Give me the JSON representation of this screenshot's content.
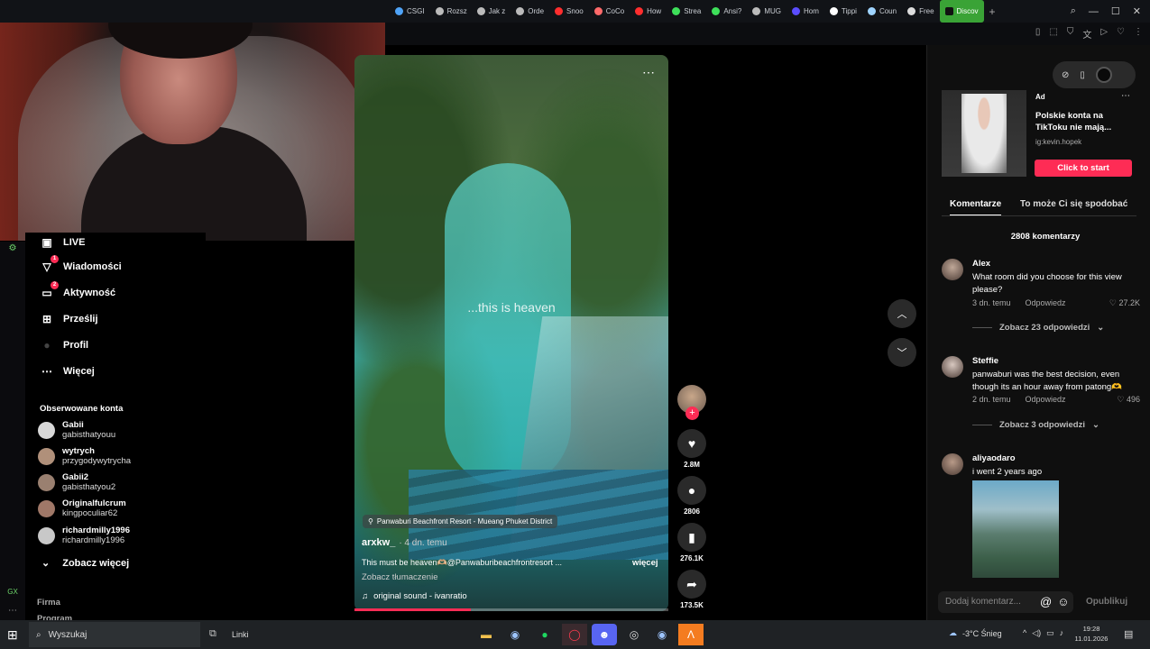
{
  "browser": {
    "tabs": [
      {
        "label": "CSGI",
        "color": "#4fa3f7"
      },
      {
        "label": "Rozsz",
        "color": "#bbbbbb"
      },
      {
        "label": "Jak z",
        "color": "#bbbbbb"
      },
      {
        "label": "Orde",
        "color": "#bbbbbb"
      },
      {
        "label": "Snoo",
        "color": "#ff2e2e"
      },
      {
        "label": "CoCo",
        "color": "#ff6a6a"
      },
      {
        "label": "How",
        "color": "#ff2e2e"
      },
      {
        "label": "Strea",
        "color": "#3ee05a"
      },
      {
        "label": "Ansi?",
        "color": "#3ee05a"
      },
      {
        "label": "MUG",
        "color": "#bbbbbb"
      },
      {
        "label": "Hom",
        "color": "#5b4dff"
      },
      {
        "label": "Tippi",
        "color": "#ffffff"
      },
      {
        "label": "Coun",
        "color": "#9fd4ff"
      },
      {
        "label": "Free",
        "color": "#dddddd"
      }
    ],
    "active_tab": {
      "label": "Discov",
      "color": "#3aa336"
    },
    "new_tab": "+"
  },
  "sidebar": {
    "items": [
      {
        "label": "LIVE",
        "icon": "live-icon"
      },
      {
        "label": "Wiadomości",
        "icon": "messages-icon",
        "badge": "1"
      },
      {
        "label": "Aktywność",
        "icon": "activity-icon",
        "badge": "2"
      },
      {
        "label": "Prześlij",
        "icon": "upload-icon"
      },
      {
        "label": "Profil",
        "icon": "profile-icon"
      },
      {
        "label": "Więcej",
        "icon": "more-icon"
      }
    ],
    "followed_title": "Obserwowane konta",
    "accounts": [
      {
        "name": "Gabii",
        "handle": "gabisthatyouu",
        "color": "#d8d8d8"
      },
      {
        "name": "wytrych",
        "handle": "przygodywytrycha",
        "color": "#b0907a"
      },
      {
        "name": "Gabii2",
        "handle": "gabisthatyou2",
        "color": "#9a8070"
      },
      {
        "name": "Originalfulcrum",
        "handle": "kingpoculiar62",
        "color": "#a07868"
      },
      {
        "name": "richardmilly1996",
        "handle": "richardmilly1996",
        "color": "#c8c8c8"
      }
    ],
    "see_more": "Zobacz więcej",
    "footer": [
      "Firma",
      "Program"
    ]
  },
  "video": {
    "overlay_text": "...this is heaven",
    "location": "Panwaburi Beachfront Resort - Mueang Phuket District",
    "author": "arxkw_",
    "time": "· 4 dn. temu",
    "caption": "This must be heaven🫶🏼@Panwaburibeachfrontresort ...",
    "more": "więcej",
    "translate": "Zobacz tłumaczenie",
    "sound": "original sound - ivanratio",
    "progress": 0.37
  },
  "actions": {
    "likes": "2.8M",
    "comments": "2806",
    "saves": "276.1K",
    "shares": "173.5K"
  },
  "ad": {
    "label": "Ad",
    "title": "Polskie konta na TikToku nie mają...",
    "sub": "ig:kevin.hopek",
    "button": "Click to start"
  },
  "panel": {
    "tab_comments": "Komentarze",
    "tab_suggest": "To może Ci się spodobać",
    "comment_count": "2808 komentarzy"
  },
  "comments": [
    {
      "name": "Alex",
      "text": "What room did you choose for this view please?",
      "time": "3 dn. temu",
      "reply": "Odpowiedz",
      "likes": "27.2K",
      "replies": "Zobacz 23 odpowiedzi",
      "avatar": "#c0a898"
    },
    {
      "name": "Steffie",
      "text": "panwaburi was the best decision, even though its an hour away from patong🫶",
      "time": "2 dn. temu",
      "reply": "Odpowiedz",
      "likes": "496",
      "replies": "Zobacz 3 odpowiedzi",
      "avatar": "#d8c8c0"
    },
    {
      "name": "aliyaodaro",
      "text": "i went 2 years ago",
      "avatar": "#b89a88"
    }
  ],
  "composer": {
    "placeholder": "Dodaj komentarz...",
    "publish": "Opublikuj"
  },
  "taskbar": {
    "search": "Wyszukaj",
    "links": "Linki",
    "weather": "-3°C  Śnieg",
    "time": "19:28",
    "date": "11.01.2026"
  }
}
